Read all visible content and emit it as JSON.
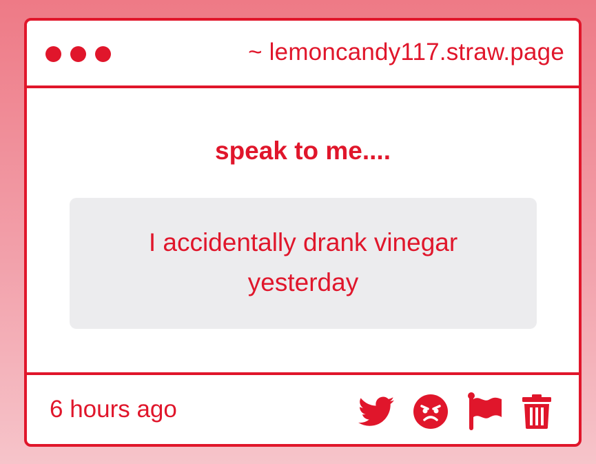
{
  "window": {
    "url": "~ lemoncandy117.straw.page"
  },
  "content": {
    "prompt": "speak to me....",
    "message": "I accidentally drank vinegar yesterday"
  },
  "footer": {
    "timestamp": "6 hours ago",
    "actions": [
      {
        "icon": "twitter-icon"
      },
      {
        "icon": "angry-face-icon"
      },
      {
        "icon": "flag-icon"
      },
      {
        "icon": "trash-icon"
      }
    ]
  },
  "colors": {
    "accent": "#e0162b",
    "box": "#ececee",
    "background_top": "#ee7a86",
    "background_bottom": "#f6c4ca"
  }
}
